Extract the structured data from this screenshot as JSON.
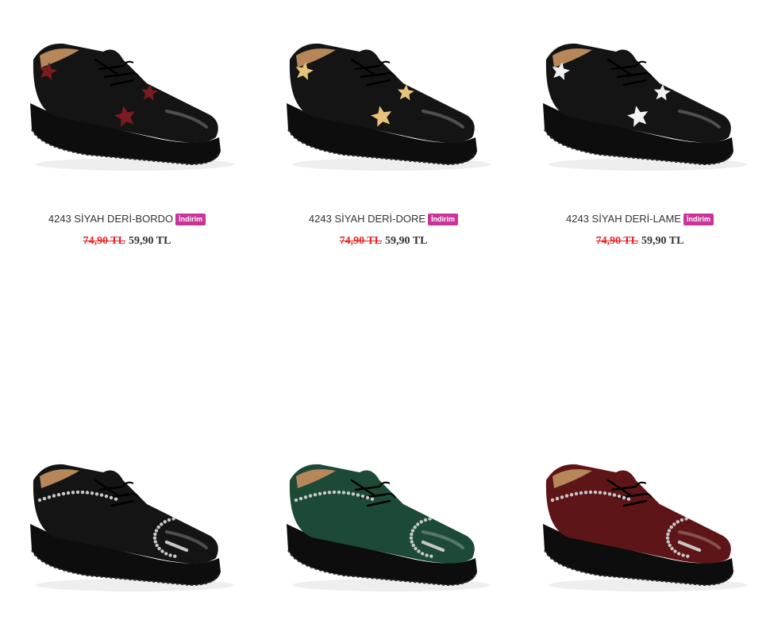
{
  "colors": {
    "badge_bg": "#cc3399",
    "old_price": "#e32526",
    "text": "#333333"
  },
  "products": [
    {
      "name": "4243 SİYAH DERİ-BORDO",
      "badge": "İndirim",
      "old_price": "74,90 TL",
      "new_price": "59,90 TL",
      "shoe_color": "#141414",
      "accent": "stars",
      "accent_color": "#7a1b1f"
    },
    {
      "name": "4243 SİYAH DERİ-DORE",
      "badge": "İndirim",
      "old_price": "74,90 TL",
      "new_price": "59,90 TL",
      "shoe_color": "#141414",
      "accent": "stars",
      "accent_color": "#e6c27a"
    },
    {
      "name": "4243 SİYAH DERİ-LAME",
      "badge": "İndirim",
      "old_price": "74,90 TL",
      "new_price": "59,90 TL",
      "shoe_color": "#141414",
      "accent": "stars",
      "accent_color": "#f2f2f2"
    },
    {
      "name": "",
      "shoe_color": "#141414",
      "accent": "studs",
      "accent_color": "#c8c8c8"
    },
    {
      "name": "",
      "shoe_color": "#1d4a37",
      "accent": "studs",
      "accent_color": "#c8c8c8"
    },
    {
      "name": "",
      "shoe_color": "#5e1518",
      "accent": "studs",
      "accent_color": "#c8c8c8"
    }
  ]
}
